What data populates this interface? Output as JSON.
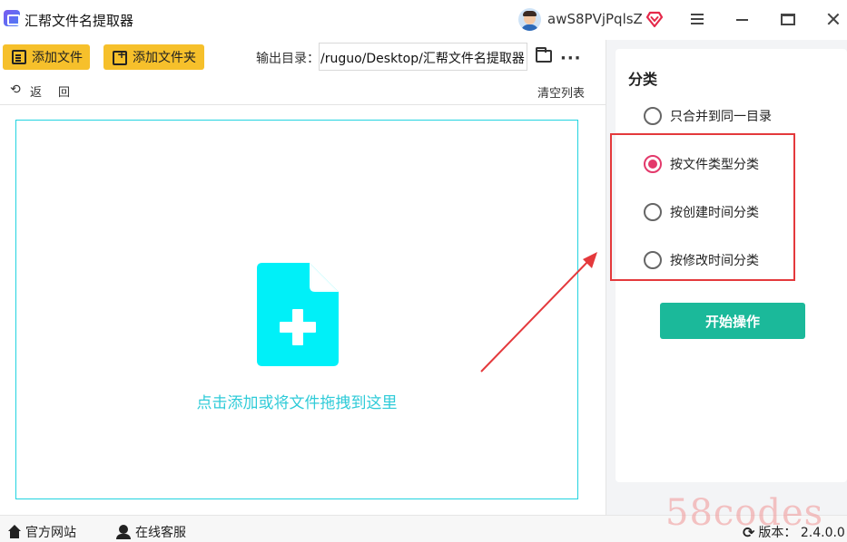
{
  "window": {
    "title": "汇帮文件名提取器",
    "username": "awS8PVjPqlsZ",
    "icons": [
      "app-logo-icon",
      "vip-badge-icon",
      "menu-icon",
      "minimize-icon",
      "maximize-icon",
      "close-icon"
    ]
  },
  "toolbar": {
    "add_file": "添加文件",
    "add_folder": "添加文件夹",
    "output_label": "输出目录：",
    "output_path": "/ruguo/Desktop/汇帮文件名提取器",
    "more": "···"
  },
  "list": {
    "back": "返回",
    "clear": "清空列表"
  },
  "dropzone": {
    "hint": "点击添加或将文件拖拽到这里",
    "icon": "file-add-icon",
    "color": "#00F0F8"
  },
  "category": {
    "title": "分类",
    "options": [
      {
        "label": "只合并到同一目录",
        "checked": false
      },
      {
        "label": "按文件类型分类",
        "checked": true
      },
      {
        "label": "按创建时间分类",
        "checked": false
      },
      {
        "label": "按修改时间分类",
        "checked": false
      }
    ],
    "start_button": "开始操作"
  },
  "statusbar": {
    "website": "官方网站",
    "service": "在线客服",
    "version": "版本：  2.4.0.0"
  },
  "watermark": "58codes",
  "colors": {
    "accent_yellow": "#F6C02B",
    "start_green": "#1BB99A",
    "radio_checked": "#E3396B",
    "highlight_red": "#E4393C",
    "drop_cyan": "#22D3E0"
  }
}
